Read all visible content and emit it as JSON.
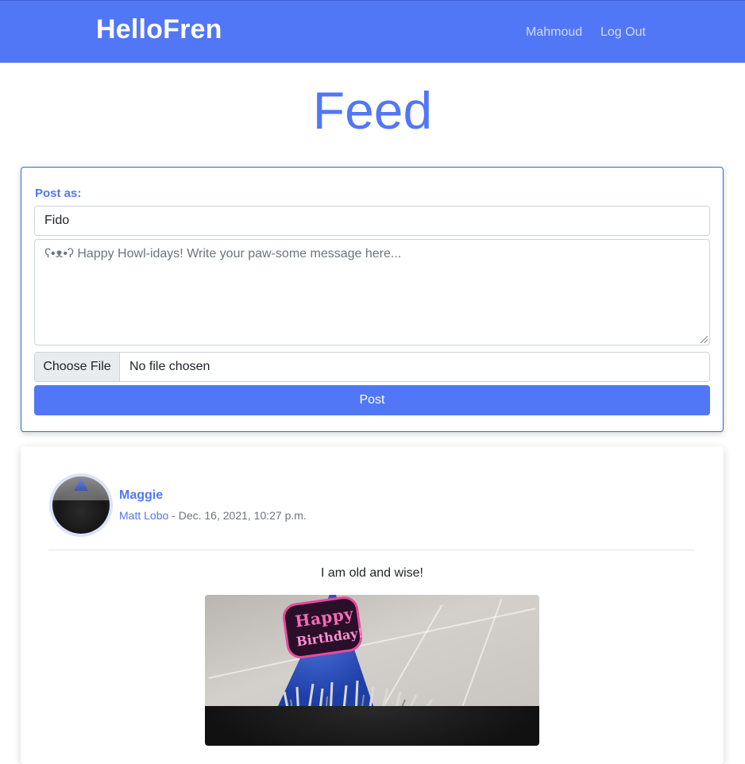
{
  "navbar": {
    "brand": "HelloFren",
    "user_link": "Mahmoud",
    "logout_link": "Log Out",
    "color": "#5177f7"
  },
  "page": {
    "title": "Feed"
  },
  "composer": {
    "post_as_label": "Post as:",
    "selected_pet": "Fido",
    "message_placeholder": "ʕ•ᴥ•ʔ Happy Howl-idays! Write your paw-some message here...",
    "file_button": "Choose File",
    "file_status": "No file chosen",
    "post_button": "Post"
  },
  "feed": {
    "posts": [
      {
        "pet_name": "Maggie",
        "owner": "Matt Lobo",
        "separator": " - ",
        "timestamp": "Dec. 16, 2021, 10:27 p.m.",
        "text": "I am old and wise!",
        "image_badge": {
          "line1": "Happy",
          "line2": "Birthday!"
        }
      }
    ]
  }
}
